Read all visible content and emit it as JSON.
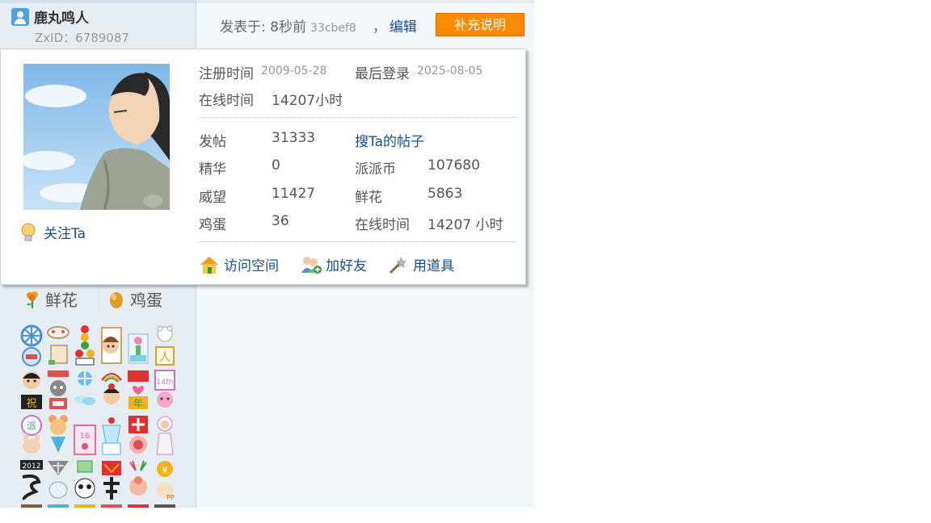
{
  "user": {
    "name": "鹿丸鸣人",
    "zxid": "ZxID：6789087"
  },
  "post": {
    "posted_label": "发表于: 8秒前",
    "hash": "33cbef8",
    "comma": "，",
    "edit_label": "编辑",
    "supplement_label": "补充说明"
  },
  "card": {
    "follow_label": "关注Ta",
    "register_label": "注册时间",
    "register_value": "2009-05-28",
    "last_login_label": "最后登录",
    "last_login_value": "2025-08-05",
    "online_label": "在线时间",
    "online_value": "14207小时",
    "stats": {
      "posts_label": "发帖",
      "posts_value": "31333",
      "search_posts_label": "搜Ta的帖子",
      "essence_label": "精华",
      "essence_value": "0",
      "paipai_label": "派派币",
      "paipai_value": "107680",
      "prestige_label": "威望",
      "prestige_value": "11427",
      "flowers_label": "鲜花",
      "flowers_value": "5863",
      "eggs_label": "鸡蛋",
      "eggs_value": "36",
      "online_label": "在线时间",
      "online_value": "14207 小时"
    },
    "actions": {
      "visit_space": "访问空间",
      "add_friend": "加好友",
      "use_item": "用道具"
    }
  },
  "gifts": {
    "flower_label": "鲜花",
    "egg_label": "鸡蛋"
  },
  "colors": {
    "accent_orange": "#ff8a00",
    "link_blue": "#1a4e8a",
    "sidebar_bg": "#e5edf2",
    "content_bg": "#f2f7fc"
  }
}
